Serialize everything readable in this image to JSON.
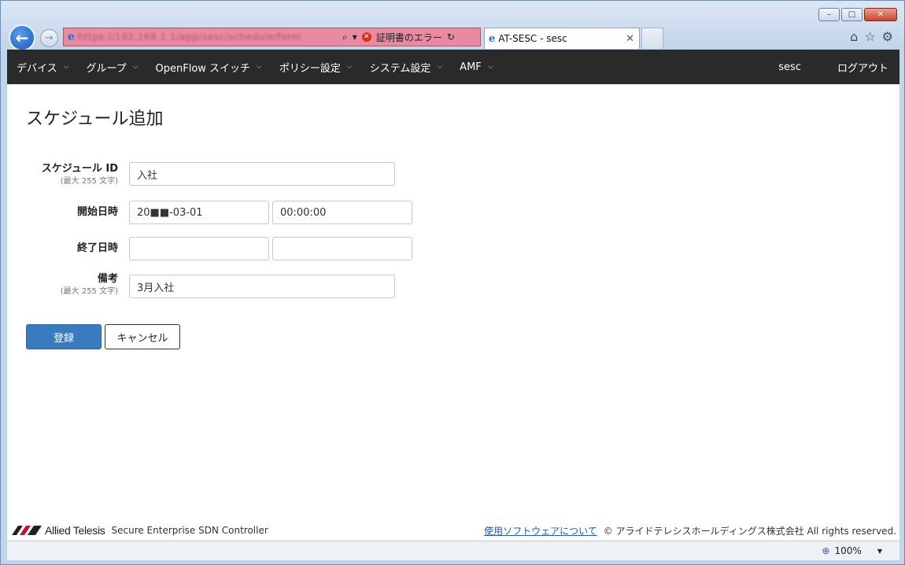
{
  "browser": {
    "url_text": "https://192.168.1.1/app/sesc/schedule/form",
    "cert_error": "証明書のエラー",
    "tab_title": "AT-SESC - sesc",
    "zoom": "100%"
  },
  "nav": {
    "items": [
      {
        "label": "デバイス"
      },
      {
        "label": "グループ"
      },
      {
        "label": "OpenFlow スイッチ"
      },
      {
        "label": "ポリシー設定"
      },
      {
        "label": "システム設定"
      },
      {
        "label": "AMF"
      }
    ],
    "user": "sesc",
    "logout": "ログアウト"
  },
  "page": {
    "title": "スケジュール追加"
  },
  "form": {
    "schedule_id": {
      "label": "スケジュール ID",
      "hint": "(最大 255 文字)",
      "value": "入社"
    },
    "start": {
      "label": "開始日時",
      "date": "20■■-03-01",
      "time": "00:00:00"
    },
    "end": {
      "label": "終了日時",
      "date": "",
      "time": ""
    },
    "note": {
      "label": "備考",
      "hint": "(最大 255 文字)",
      "value": "3月入社"
    }
  },
  "buttons": {
    "submit": "登録",
    "cancel": "キャンセル"
  },
  "footer": {
    "brand": "Allied Telesis",
    "product": "Secure Enterprise SDN Controller",
    "link": "使用ソフトウェアについて",
    "copyright": "© アライドテレシスホールディングス株式会社 All rights reserved."
  },
  "colors": {
    "primary": "#3a7bbf",
    "navbar": "#2a2a2a",
    "address_error": "#e88aa0"
  }
}
